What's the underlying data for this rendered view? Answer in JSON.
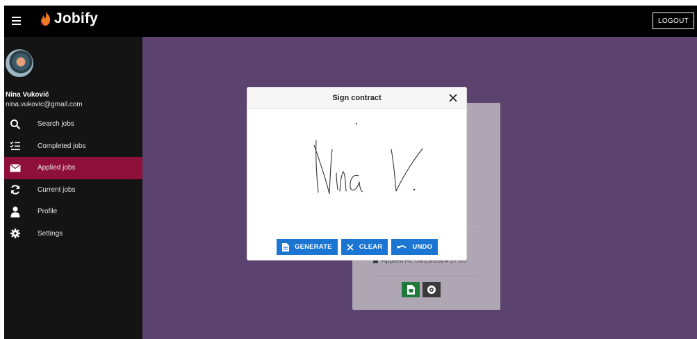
{
  "app": {
    "brand": "Jobify",
    "logout_label": "LOGOUT"
  },
  "user": {
    "name": "Nina Vuković",
    "email": "nina.vukovic@gmail.com"
  },
  "sidebar": {
    "items": [
      {
        "label": "Search jobs",
        "icon": "search-icon",
        "active": false
      },
      {
        "label": "Completed jobs",
        "icon": "checklist-icon",
        "active": false
      },
      {
        "label": "Applied jobs",
        "icon": "envelope-icon",
        "active": true
      },
      {
        "label": "Current jobs",
        "icon": "refresh-icon",
        "active": false
      },
      {
        "label": "Profile",
        "icon": "user-icon",
        "active": false
      },
      {
        "label": "Settings",
        "icon": "gear-icon",
        "active": false
      }
    ],
    "active_color": "#8f0f3b"
  },
  "job_card": {
    "applied_at": "Applied At: 08/25/2024 17:05"
  },
  "modal": {
    "title": "Sign contract",
    "signature_text": "Nina V.",
    "buttons": {
      "generate": "GENERATE",
      "clear": "CLEAR",
      "undo": "UNDO"
    }
  },
  "colors": {
    "topbar": "#000000",
    "sidebar": "#141414",
    "main_bg": "#5c426e",
    "primary_button": "#1a76d2",
    "pdf_button": "#1f7a3a"
  }
}
